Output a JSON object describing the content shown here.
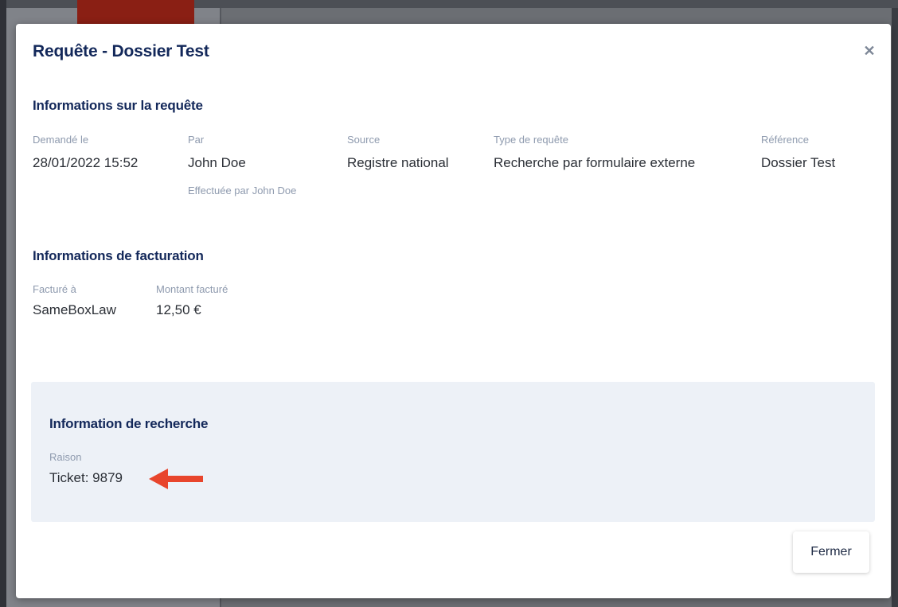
{
  "modal": {
    "title": "Requête - Dossier Test",
    "close_icon": "close-icon",
    "close_glyph": "✕"
  },
  "request_info": {
    "title": "Informations sur la requête",
    "fields": [
      {
        "label": "Demandé le",
        "value": "28/01/2022 15:52"
      },
      {
        "label": "Par",
        "value": "John Doe",
        "sub": "Effectuée par John Doe"
      },
      {
        "label": "Source",
        "value": "Registre national"
      },
      {
        "label": "Type de requête",
        "value": "Recherche par formulaire externe"
      },
      {
        "label": "Référence",
        "value": "Dossier Test"
      }
    ]
  },
  "billing_info": {
    "title": "Informations de facturation",
    "fields": [
      {
        "label": "Facturé à",
        "value": "SameBoxLaw"
      },
      {
        "label": "Montant facturé",
        "value": "12,50 €"
      }
    ]
  },
  "search_info": {
    "title": "Information de recherche",
    "fields": [
      {
        "label": "Raison",
        "value": "Ticket: 9879"
      }
    ]
  },
  "footer": {
    "close_label": "Fermer"
  },
  "colors": {
    "heading": "#13285a",
    "label": "#8e9aae",
    "value": "#2b2f36",
    "panel_bg": "#edf1f7",
    "arrow": "#e8452c",
    "accent_red": "#8a1f14"
  },
  "annotation": {
    "arrow_icon": "arrow-left-icon"
  }
}
